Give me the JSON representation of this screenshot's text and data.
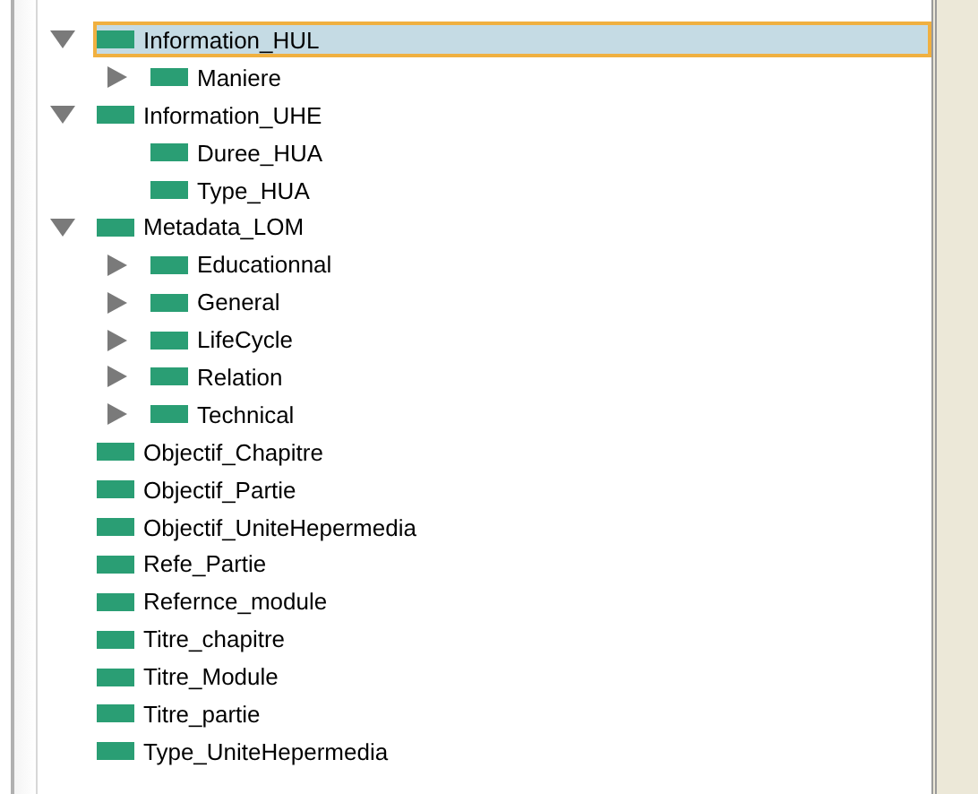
{
  "tree": [
    {
      "label": "Information_HUL",
      "expanded": true,
      "selected": true,
      "children": [
        {
          "label": "Maniere",
          "expanded": false,
          "selected": false
        }
      ]
    },
    {
      "label": "Information_UHE",
      "expanded": true,
      "selected": false,
      "children": [
        {
          "label": "Duree_HUA",
          "selected": false
        },
        {
          "label": "Type_HUA",
          "selected": false
        }
      ]
    },
    {
      "label": "Metadata_LOM",
      "expanded": true,
      "selected": false,
      "children": [
        {
          "label": "Educationnal",
          "expanded": false,
          "selected": false
        },
        {
          "label": "General",
          "expanded": false,
          "selected": false
        },
        {
          "label": "LifeCycle",
          "expanded": false,
          "selected": false
        },
        {
          "label": "Relation",
          "expanded": false,
          "selected": false
        },
        {
          "label": "Technical",
          "expanded": false,
          "selected": false
        }
      ]
    },
    {
      "label": "Objectif_Chapitre",
      "selected": false
    },
    {
      "label": "Objectif_Partie",
      "selected": false
    },
    {
      "label": "Objectif_UniteHepermedia",
      "selected": false
    },
    {
      "label": "Refe_Partie",
      "selected": false
    },
    {
      "label": "Refernce_module",
      "selected": false
    },
    {
      "label": "Titre_chapitre",
      "selected": false
    },
    {
      "label": "Titre_Module",
      "selected": false
    },
    {
      "label": "Titre_partie",
      "selected": false
    },
    {
      "label": "Type_UniteHepermedia",
      "selected": false
    }
  ]
}
